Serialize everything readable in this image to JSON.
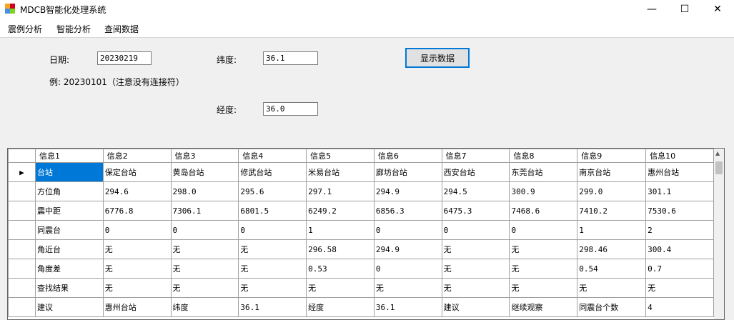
{
  "window": {
    "title": "MDCB智能化处理系统",
    "min_glyph": "—",
    "max_glyph": "☐",
    "close_glyph": "✕"
  },
  "menu": {
    "items": [
      "震例分析",
      "智能分析",
      "查阅数据"
    ]
  },
  "form": {
    "date_label": "日期:",
    "date_value": "20230219",
    "date_hint": "例: 20230101（注意没有连接符）",
    "lat_label": "纬度:",
    "lat_value": "36.1",
    "lon_label": "经度:",
    "lon_value": "36.0",
    "show_button": "显示数据"
  },
  "grid": {
    "columns": [
      "信息1",
      "信息2",
      "信息3",
      "信息4",
      "信息5",
      "信息6",
      "信息7",
      "信息8",
      "信息9",
      "信息10"
    ],
    "current_row_marker": "▶",
    "rows": [
      [
        "台站",
        "保定台站",
        "黄岛台站",
        "修武台站",
        "米易台站",
        "廊坊台站",
        "西安台站",
        "东莞台站",
        "南京台站",
        "惠州台站"
      ],
      [
        "方位角",
        "294.6",
        "298.0",
        "295.6",
        "297.1",
        "294.9",
        "294.5",
        "300.9",
        "299.0",
        "301.1"
      ],
      [
        "震中距",
        "6776.8",
        "7306.1",
        "6801.5",
        "6249.2",
        "6856.3",
        "6475.3",
        "7468.6",
        "7410.2",
        "7530.6"
      ],
      [
        "同震台",
        "0",
        "0",
        "0",
        "1",
        "0",
        "0",
        "0",
        "1",
        "2"
      ],
      [
        "角近台",
        "无",
        "无",
        "无",
        "296.58",
        "294.9",
        "无",
        "无",
        "298.46",
        "300.4"
      ],
      [
        "角度差",
        "无",
        "无",
        "无",
        "0.53",
        "0",
        "无",
        "无",
        "0.54",
        "0.7"
      ],
      [
        "查找结果",
        "无",
        "无",
        "无",
        "无",
        "无",
        "无",
        "无",
        "无",
        "无"
      ],
      [
        "建议",
        "惠州台站",
        "纬度",
        "36.1",
        "经度",
        "36.1",
        "建议",
        "继续观察",
        "同震台个数",
        "4"
      ]
    ]
  }
}
